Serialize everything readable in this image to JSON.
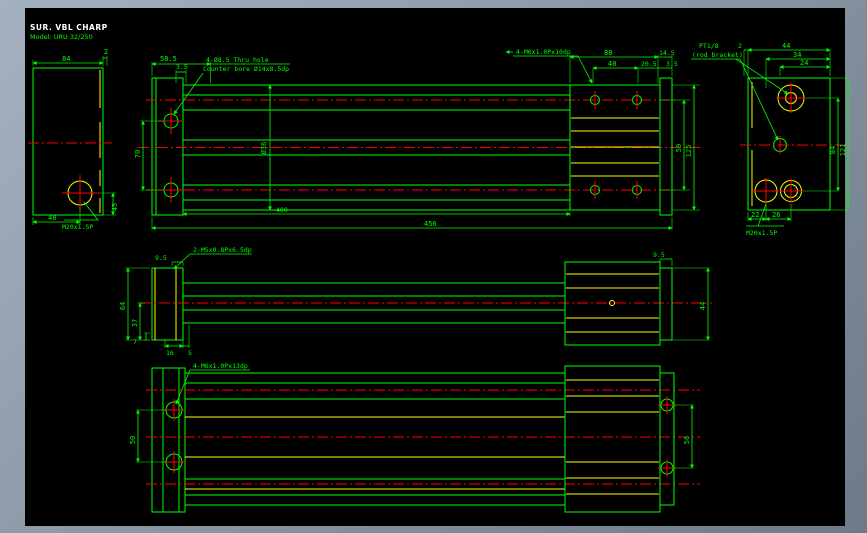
{
  "app": {
    "title_line1": "SUR. VBL CHARP",
    "title_line2": "Model: URU 32/250"
  },
  "colors": {
    "frame": "#8b98a6",
    "canvas": "#000000",
    "geometry_green": "#00ff00",
    "geometry_yellow": "#ffff00",
    "centerline_red": "#ff0000",
    "title_white": "#ffffff"
  },
  "views": {
    "end_left": {
      "dim_width": "84",
      "dim_offset": "2",
      "dim_bottom": "48",
      "dim_side": "45",
      "note_thread": "M20x1.5P"
    },
    "front": {
      "dim_plate": "58.5",
      "dim_step": "3.5",
      "note_cbore_1": "4-Ø8.5 Thru hole",
      "note_cbore_2": "Counter bore Ø14x8.5dp",
      "note_tap": "4-M6x1.0Px10dp",
      "dim_head": "88",
      "dim_head_inner": "40",
      "dim_head_step": "20.5",
      "dim_cap": "14.5",
      "dim_cap_step": "3.5",
      "dim_bore": "Ø36",
      "dim_rod_pitch": "70",
      "dim_right_inner": "59",
      "dim_right_outer": "125",
      "dim_body": "400",
      "dim_total": "456"
    },
    "end_right": {
      "dim_offset": "2",
      "dim_w1": "44",
      "dim_w2": "34",
      "dim_w3": "24",
      "dim_h_inner": "84",
      "dim_h_outer": "121",
      "dim_b1": "22",
      "dim_b2": "26",
      "note_port_1": "PT1/8",
      "note_port_2": "(rod bracket)",
      "note_thread": "M20x1.5P"
    },
    "top": {
      "dim_cap_left": "9.5",
      "dim_cap_right": "9.5",
      "note_tap": "2-M5x0.8Px6.5dp",
      "dim_height": "64",
      "dim_half": "37",
      "dim_b1": "16",
      "dim_b2": "5",
      "dim_b3": "7",
      "dim_right_height": "44"
    },
    "bottom": {
      "note_tap": "4-M6x1.0Px13dp",
      "dim_hole_pitch": "50",
      "dim_right_pitch": "56"
    }
  }
}
